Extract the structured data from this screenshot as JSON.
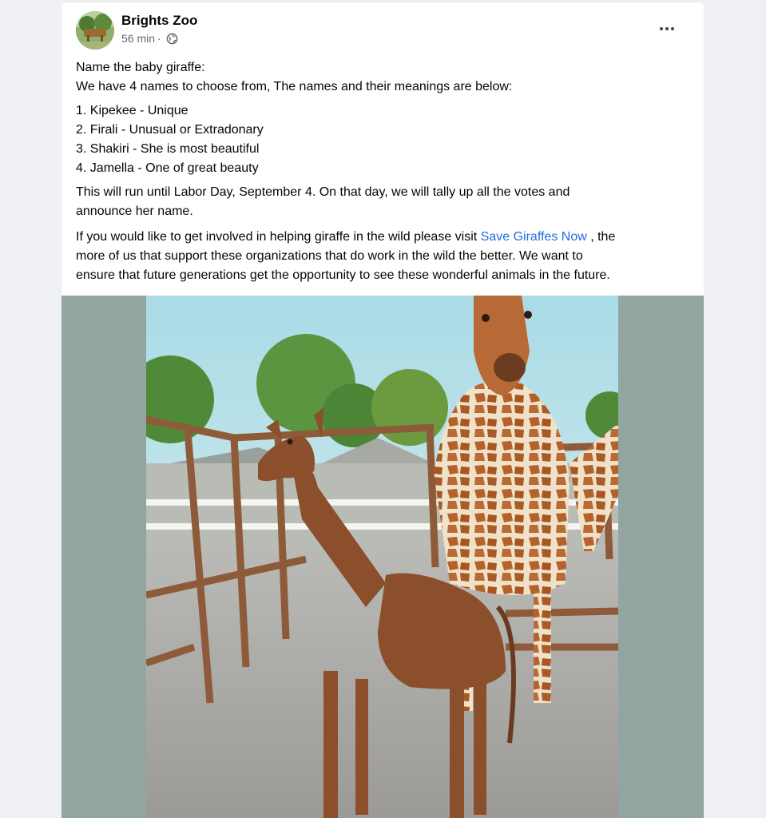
{
  "post": {
    "author": "Brights Zoo",
    "time": "56 min",
    "separator": "·",
    "icons": {
      "privacy": "globe-icon",
      "menu": "more-options-icon"
    },
    "text": {
      "heading": "Name the baby giraffe:",
      "intro": "We have 4 names to choose from, The names and their meanings are below:",
      "names": [
        "1.  Kipekee - Unique",
        "2.  Firali - Unusual or Extradonary",
        "3.  Shakiri - She is most beautiful",
        "4.  Jamella - One of great beauty"
      ],
      "run_line1": "This will run until Labor Day, September 4.    On that day, we will tally up all the votes and",
      "run_line2": "announce her name.",
      "involve_pre": " If you would like to get involved in helping giraffe in the wild please visit ",
      "involve_link": "Save Giraffes Now",
      "involve_post1": " ,  the",
      "involve_line2": "more of us that support these organizations that do work in the wild the better.    We want to",
      "involve_line3": "ensure that future generations get the opportunity to see these wonderful animals in the future."
    }
  },
  "colors": {
    "link": "#216fdb",
    "photo_background": "#93a5a1",
    "meta_text": "#65676b"
  }
}
